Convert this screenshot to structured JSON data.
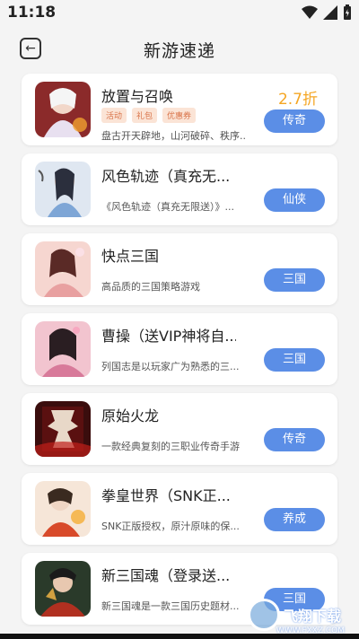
{
  "status": {
    "time": "11:18"
  },
  "header": {
    "title": "新游速递"
  },
  "games": [
    {
      "title": "放置与召唤",
      "desc": "盘古开天辟地，山河破碎、秩序...",
      "tags": [
        "活动",
        "礼包",
        "优惠券"
      ],
      "discount": "2.7折",
      "category": "传奇",
      "icon": "game-icon-summon"
    },
    {
      "title": "风色轨迹（真充无...",
      "desc": "《风色轨迹（真充无限送）》...",
      "category": "仙侠",
      "icon": "game-icon-wind"
    },
    {
      "title": "快点三国",
      "desc": "高品质的三国策略游戏",
      "category": "三国",
      "icon": "game-icon-three-kingdoms"
    },
    {
      "title": "曹操（送VIP神将自...",
      "desc": "列国志是以玩家广为熟悉的三...",
      "category": "三国",
      "icon": "game-icon-caocao"
    },
    {
      "title": "原始火龙",
      "desc": "一款经典复刻的三职业传奇手游",
      "category": "传奇",
      "icon": "game-icon-dragon"
    },
    {
      "title": "拳皇世界（SNK正...",
      "desc": "SNK正版授权，原汁原味的保...",
      "category": "养成",
      "icon": "game-icon-kof"
    },
    {
      "title": "新三国魂（登录送...",
      "desc": "新三国魂是一款三国历史题材...",
      "category": "三国",
      "icon": "game-icon-soul"
    }
  ],
  "watermark": {
    "text": "飞翔下载",
    "sub": "WWW.FXXZ.COM"
  },
  "colors": {
    "accent": "#5b8ee6",
    "discount": "#f5a623",
    "tag_bg": "#fbe4d6",
    "tag_text": "#d9744a"
  }
}
